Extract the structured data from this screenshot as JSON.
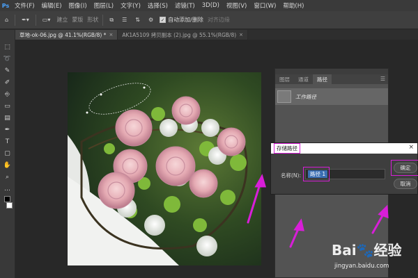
{
  "menubar": {
    "logo": "Ps",
    "items": [
      "文件(F)",
      "编辑(E)",
      "图像(I)",
      "图层(L)",
      "文字(Y)",
      "选择(S)",
      "滤镜(T)",
      "3D(D)",
      "视图(V)",
      "窗口(W)",
      "帮助(H)"
    ]
  },
  "options_bar": {
    "items": [
      "建立",
      "蒙版",
      "形状"
    ],
    "auto_add_delete": "自动添加/删除",
    "align_edges": "对齐边缘"
  },
  "document_tabs": [
    {
      "label": "草地-ok-06.jpg @ 41.1%(RGB/8) *",
      "close": "×"
    },
    {
      "label": "AK1A5109 拷贝副本 (2).jpg @ 55.1%(RGB/8)",
      "close": "×"
    }
  ],
  "toolbar": {
    "tools": [
      {
        "name": "marquee-tool-icon",
        "glyph": "⬚"
      },
      {
        "name": "lasso-tool-icon",
        "glyph": "➰"
      },
      {
        "name": "eyedropper-tool-icon",
        "glyph": "✎"
      },
      {
        "name": "brush-tool-icon",
        "glyph": "✐"
      },
      {
        "name": "stamp-tool-icon",
        "glyph": "⎆"
      },
      {
        "name": "eraser-tool-icon",
        "glyph": "▭"
      },
      {
        "name": "gradient-tool-icon",
        "glyph": "▤"
      },
      {
        "name": "pen-tool-icon",
        "glyph": "✒"
      },
      {
        "name": "type-tool-icon",
        "glyph": "T"
      },
      {
        "name": "shape-tool-icon",
        "glyph": "▢"
      },
      {
        "name": "hand-tool-icon",
        "glyph": "✋"
      },
      {
        "name": "zoom-tool-icon",
        "glyph": "⌕"
      },
      {
        "name": "more-tools-icon",
        "glyph": "…"
      }
    ]
  },
  "paths_panel": {
    "tabs": [
      "图层",
      "通道",
      "路径"
    ],
    "active_tab": "路径",
    "path_item": "工作路径"
  },
  "save_path_dialog": {
    "title": "存储路径",
    "close": "×",
    "name_label": "名称(N):",
    "name_value": "路径 1",
    "ok_label": "确定",
    "cancel_label": "取消"
  },
  "watermark": {
    "logo": "Bai🐾经验",
    "site": "jingyan.baidu.com"
  },
  "colors": {
    "annotation": "#d81ed8",
    "selection_blue": "#3b6fb3"
  }
}
